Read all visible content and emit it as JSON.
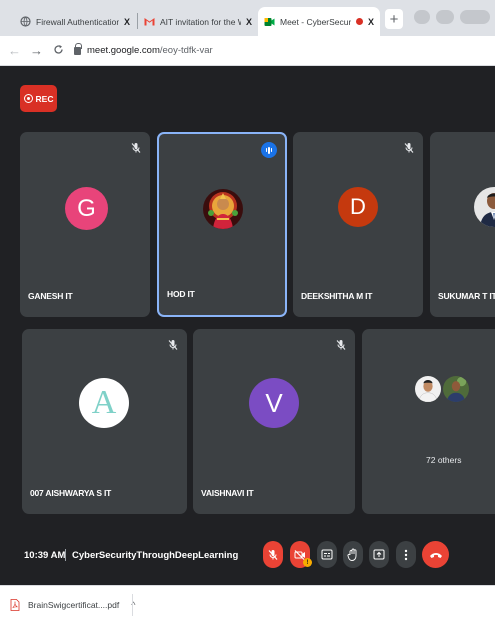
{
  "browser": {
    "tabs": [
      {
        "title": "Firewall Authentication Keepalive",
        "close": "X",
        "favicon": "globe-icon",
        "active": false
      },
      {
        "title": "AIT invitation for the Workshop - ",
        "close": "X",
        "favicon": "gmail-icon",
        "active": false
      },
      {
        "title": "Meet - CyberSecurityThroughDe",
        "close": "X",
        "favicon": "meet-icon",
        "active": true,
        "recording": true
      }
    ],
    "new_tab": "+",
    "url_host": "meet.google.com",
    "url_path": "/eoy-tdfk-var"
  },
  "meet": {
    "rec_label": "REC",
    "participants": [
      {
        "name": "GANESH IT",
        "initial": "G",
        "color": "#e8447a",
        "muted": true
      },
      {
        "name": "HOD IT",
        "initial": "",
        "avatar_kind": "photo",
        "speaking": true
      },
      {
        "name": "DEEKSHITHA M IT",
        "initial": "D",
        "color": "#c5390e",
        "muted": true
      },
      {
        "name": "SUKUMAR T IT",
        "initial": "",
        "avatar_kind": "photo"
      },
      {
        "name": "007 AISHWARYA S IT",
        "initial": "A",
        "color": "#ffffff",
        "muted": true
      },
      {
        "name": "VAISHNAVI IT",
        "initial": "V",
        "color": "#7b4cc3",
        "muted": true
      }
    ],
    "others_label": "72 others",
    "time": "10:39 AM",
    "meeting_name": "CyberSecurityThroughDeepLearning",
    "controls": [
      "mic-off-icon",
      "camera-off-icon",
      "captions-icon",
      "raise-hand-icon",
      "present-icon",
      "more-icon",
      "hangup-icon"
    ],
    "camera_badge": "!"
  },
  "downloads": {
    "file": "BrainSwigcertificat....pdf",
    "chevron": "^"
  },
  "colors": {
    "meet_bg": "#202124",
    "tile_bg": "#3c4043",
    "red": "#ea4335",
    "speaking_border": "#8ab4f8"
  }
}
